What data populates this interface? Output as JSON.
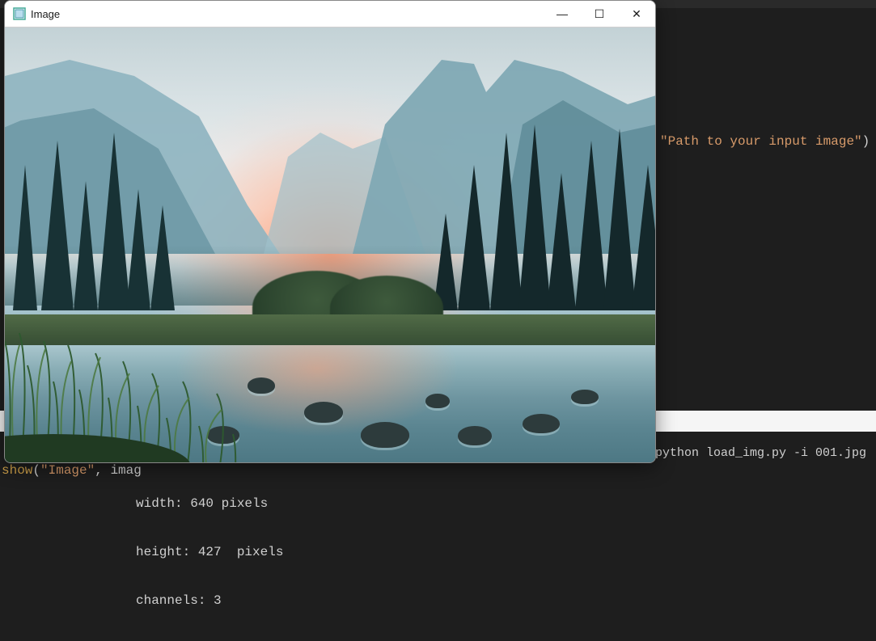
{
  "window": {
    "title": "Image",
    "controls": {
      "minimize_glyph": "—",
      "maximize_glyph": "☐",
      "close_glyph": "✕"
    }
  },
  "code_right": {
    "string": "\"Path to your input image\"",
    "closing": ")"
  },
  "terminal_right": {
    "command": "python load_img.py -i 001.jpg"
  },
  "terminal_bottom": {
    "call_fn": "show",
    "call_open": "(",
    "call_arg1": "\"Image\"",
    "call_sep": ", ",
    "call_arg2_partial": "imag"
  },
  "stdout": {
    "line1": "width: 640 pixels",
    "line2": "height: 427  pixels",
    "line3": "channels: 3"
  }
}
